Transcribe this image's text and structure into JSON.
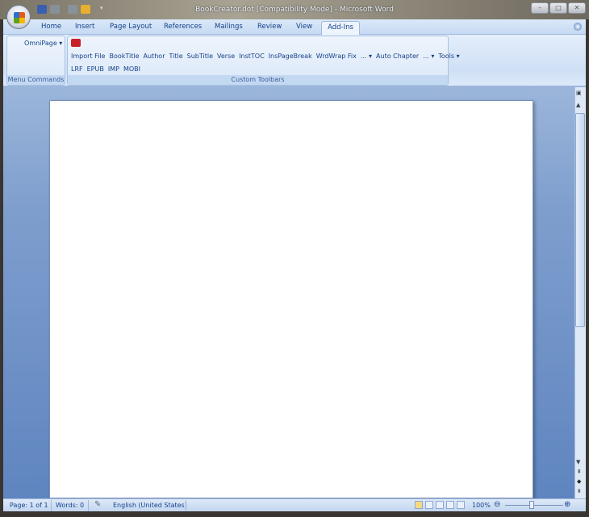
{
  "window": {
    "title": "BookCreator.dot [Compatibility Mode] - Microsoft Word"
  },
  "tabs": [
    "Home",
    "Insert",
    "Page Layout",
    "References",
    "Mailings",
    "Review",
    "View",
    "Add-Ins"
  ],
  "ribbon": {
    "menu_commands": {
      "button": "OmniPage",
      "label": "Menu Commands"
    },
    "custom_toolbars": {
      "row1": [
        "Import File",
        "BookTitle",
        "Author",
        "Title",
        "SubTitle",
        "Verse",
        "InstTOC",
        "InsPageBreak",
        "WrdWrap Fix"
      ],
      "dropdowns": [
        "...",
        "Auto Chapter",
        "...",
        "Tools"
      ],
      "row2": [
        "LRF",
        "EPUB",
        "IMP",
        "MOBI"
      ],
      "label": "Custom Toolbars"
    }
  },
  "status": {
    "page": "Page: 1 of 1",
    "words": "Words: 0",
    "language": "English (United States)",
    "zoom": "100%"
  }
}
